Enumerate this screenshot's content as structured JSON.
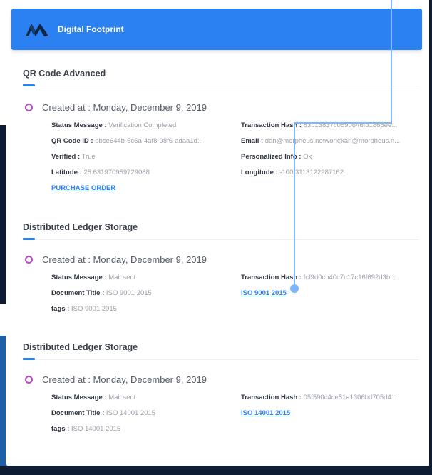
{
  "header": {
    "title": "Digital Footprint",
    "logo": "morpheus-logo"
  },
  "sections": [
    {
      "title": "QR Code Advanced",
      "created_label": "Created at : Monday, December 9, 2019",
      "status_label": "Status Message :",
      "status_value": "Verification Completed",
      "hash_label": "Transaction Hash :",
      "hash_value": "83b13837c0590846fb1866ee...",
      "qr_label": "QR Code ID :",
      "qr_value": "bbce644b-5c6a-4af8-98f6-adaa1d...",
      "email_label": "Email :",
      "email_value": "dan@morpheus.network;karl@morpheus.n...",
      "verified_label": "Verified :",
      "verified_value": "True",
      "pinfo_label": "Personalized Info :",
      "pinfo_value": "Ok",
      "lat_label": "Latitude :",
      "lat_value": "25.631970959729088",
      "lon_label": "Longitude :",
      "lon_value": "-100.3113122987162",
      "link": "PURCHASE ORDER"
    },
    {
      "title": "Distributed Ledger Storage",
      "created_label": "Created at : Monday, December 9, 2019",
      "status_label": "Status Message :",
      "status_value": "Mail sent",
      "hash_label": "Transaction Hash :",
      "hash_value": "fcf9d0cb40c7c17c16f692d3b...",
      "doc_label": "Document Title :",
      "doc_value": "ISO 9001 2015",
      "link": "ISO 9001 2015",
      "tags_label": "tags :",
      "tags_value": "ISO 9001 2015"
    },
    {
      "title": "Distributed Ledger Storage",
      "created_label": "Created at : Monday, December 9, 2019",
      "status_label": "Status Message :",
      "status_value": "Mail sent",
      "hash_label": "Transaction Hash :",
      "hash_value": "05f590c4ce51a1306bd705d4...",
      "doc_label": "Document Title :",
      "doc_value": "ISO 14001 2015",
      "link": "ISO 14001 2015",
      "tags_label": "tags :",
      "tags_value": "ISO 14001 2015"
    }
  ],
  "colors": {
    "accent": "#2b80f2",
    "ring": "#b44ec2",
    "connector": "#7fb6ff"
  }
}
